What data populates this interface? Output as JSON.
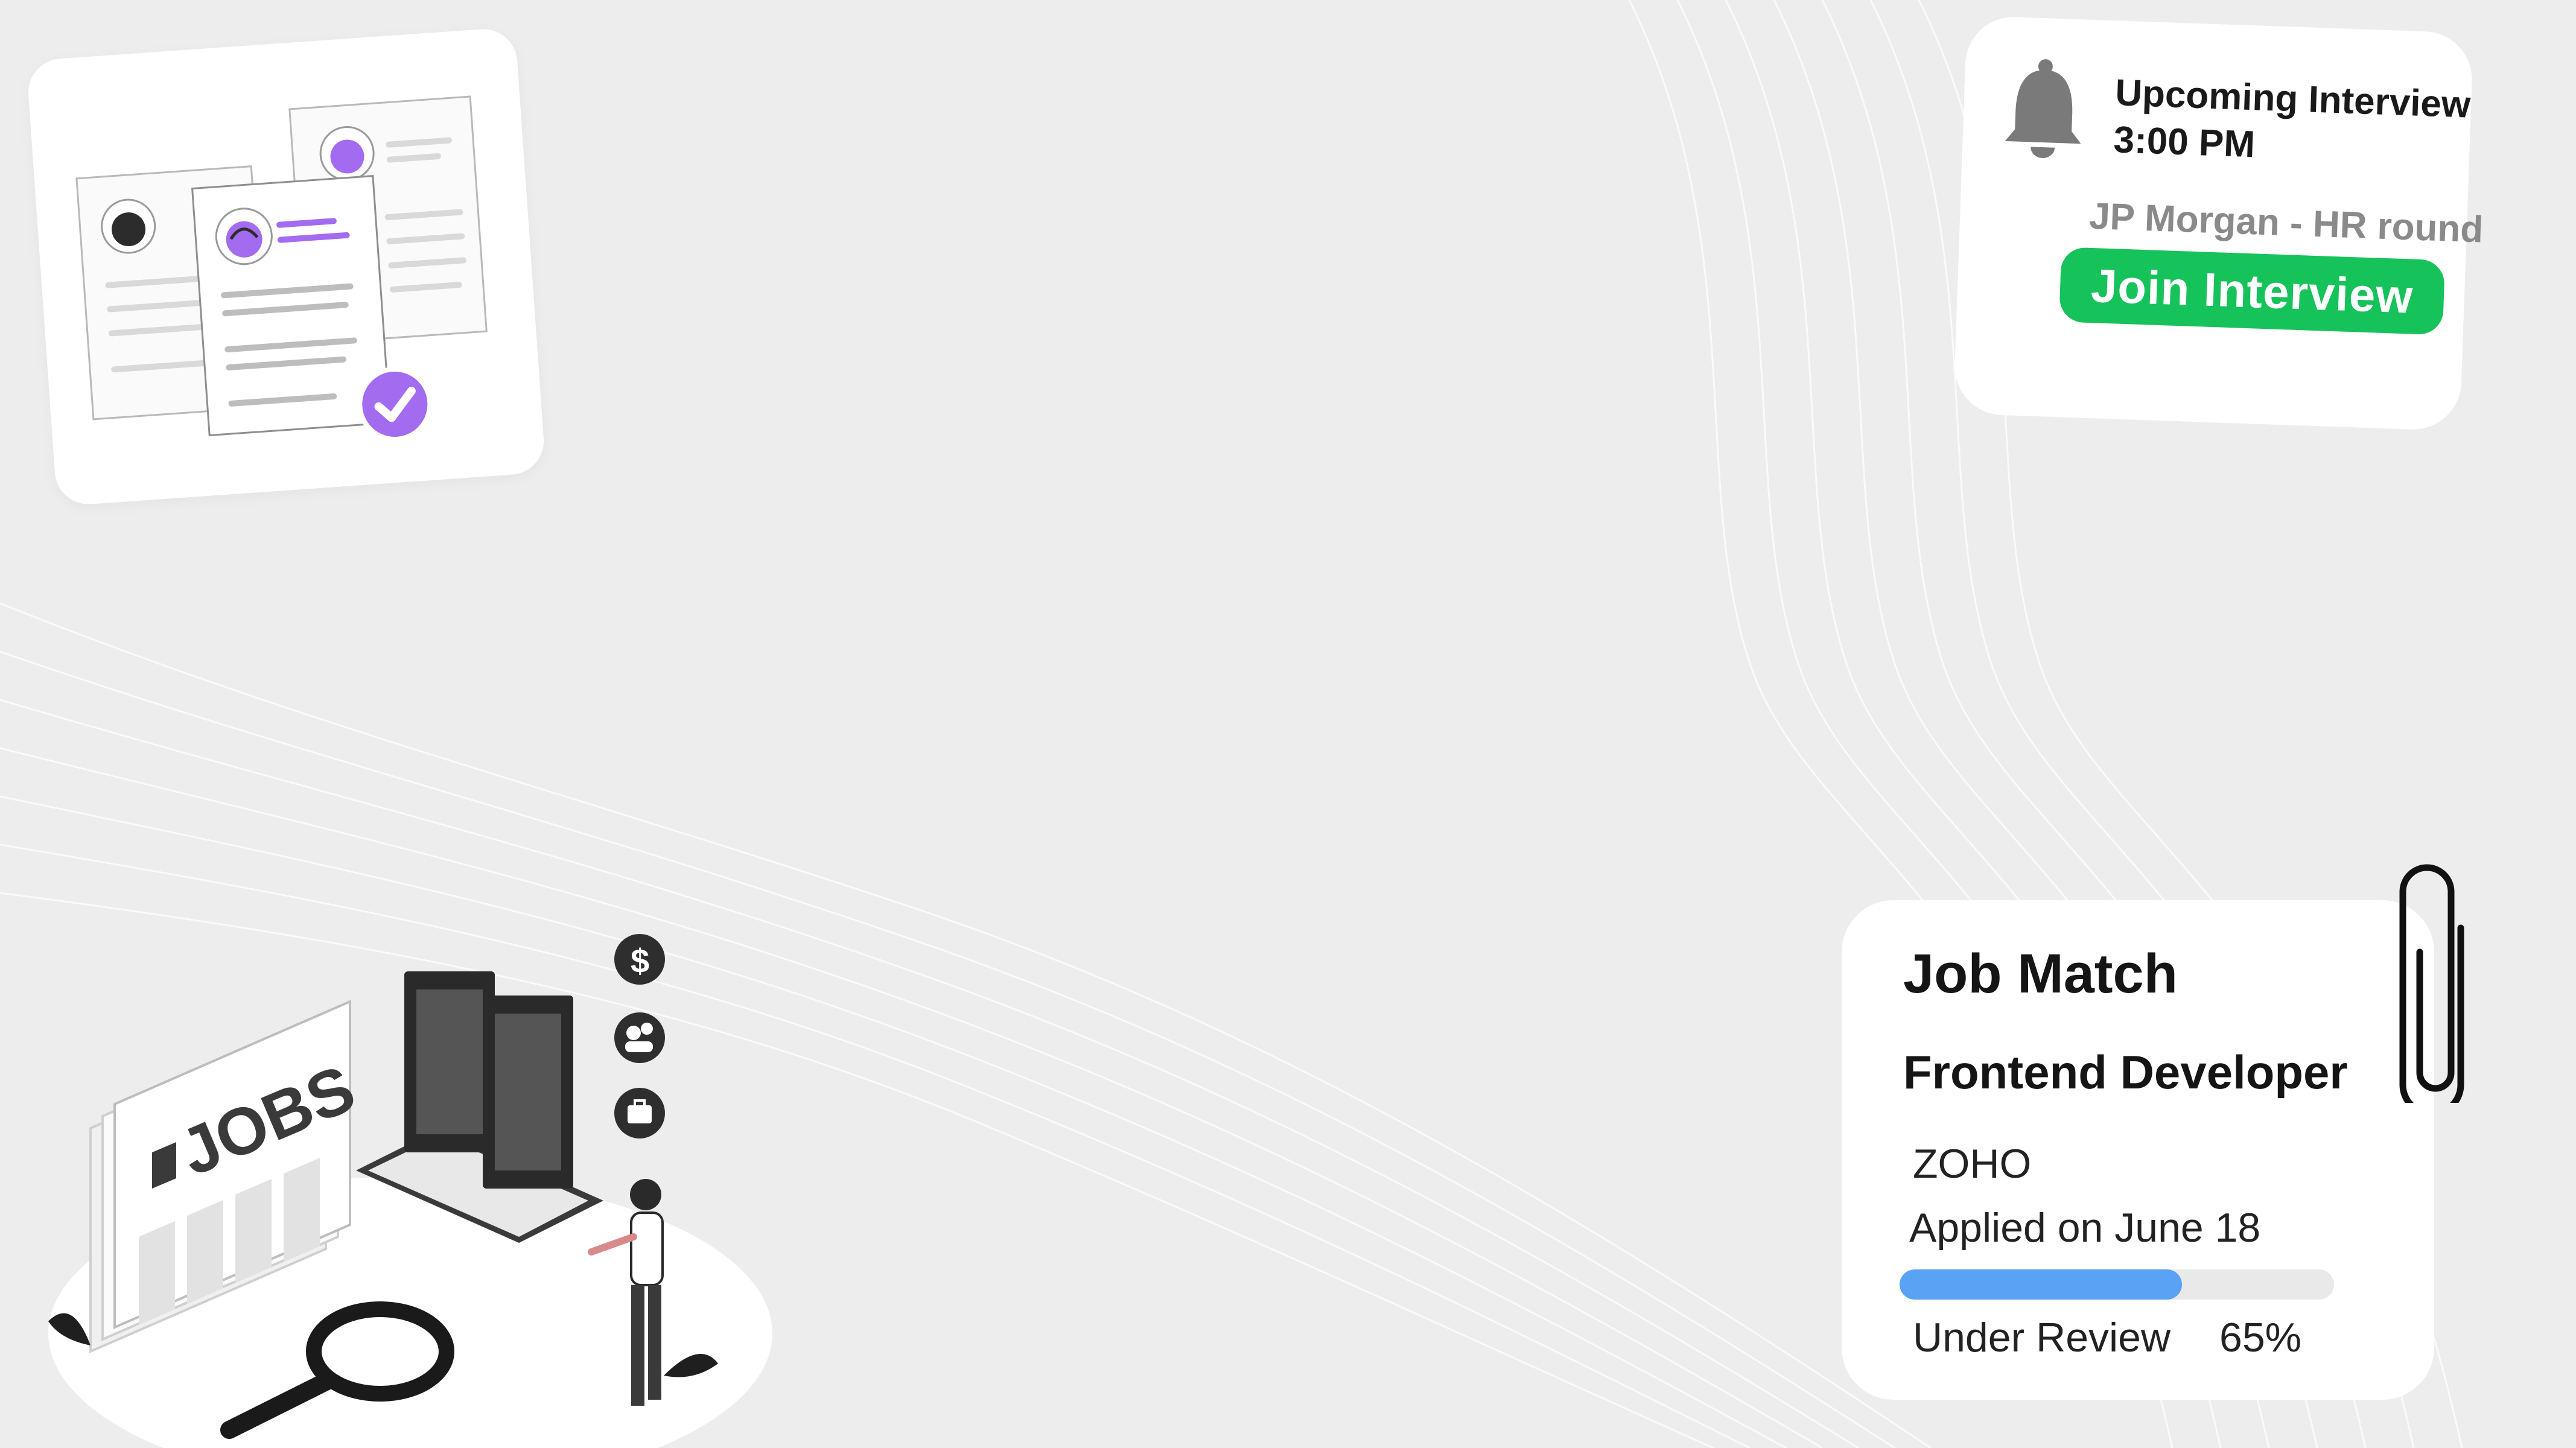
{
  "interview_card": {
    "icon": "bell-icon",
    "title": "Upcoming Interview",
    "time": "3:00 PM",
    "company_round": "JP Morgan - HR round",
    "join_button_label": "Join Interview",
    "button_color": "#16c25a"
  },
  "job_card": {
    "title": "Job Match",
    "role": "Frontend Developer",
    "company": "ZOHO",
    "applied": "Applied on June 18",
    "status": "Under Review",
    "progress_label": "65%",
    "progress_value": 0.65,
    "progress_color": "#5aa2f4",
    "icon": "paperclip-icon"
  },
  "resume_illustration": {
    "icon": "checkmark-icon",
    "accent": "#a36bef"
  },
  "jobs_illustration": {
    "sign_text": "JOBS",
    "icons": [
      "dollar-icon",
      "people-icon",
      "briefcase-icon",
      "magnifier-icon"
    ]
  }
}
